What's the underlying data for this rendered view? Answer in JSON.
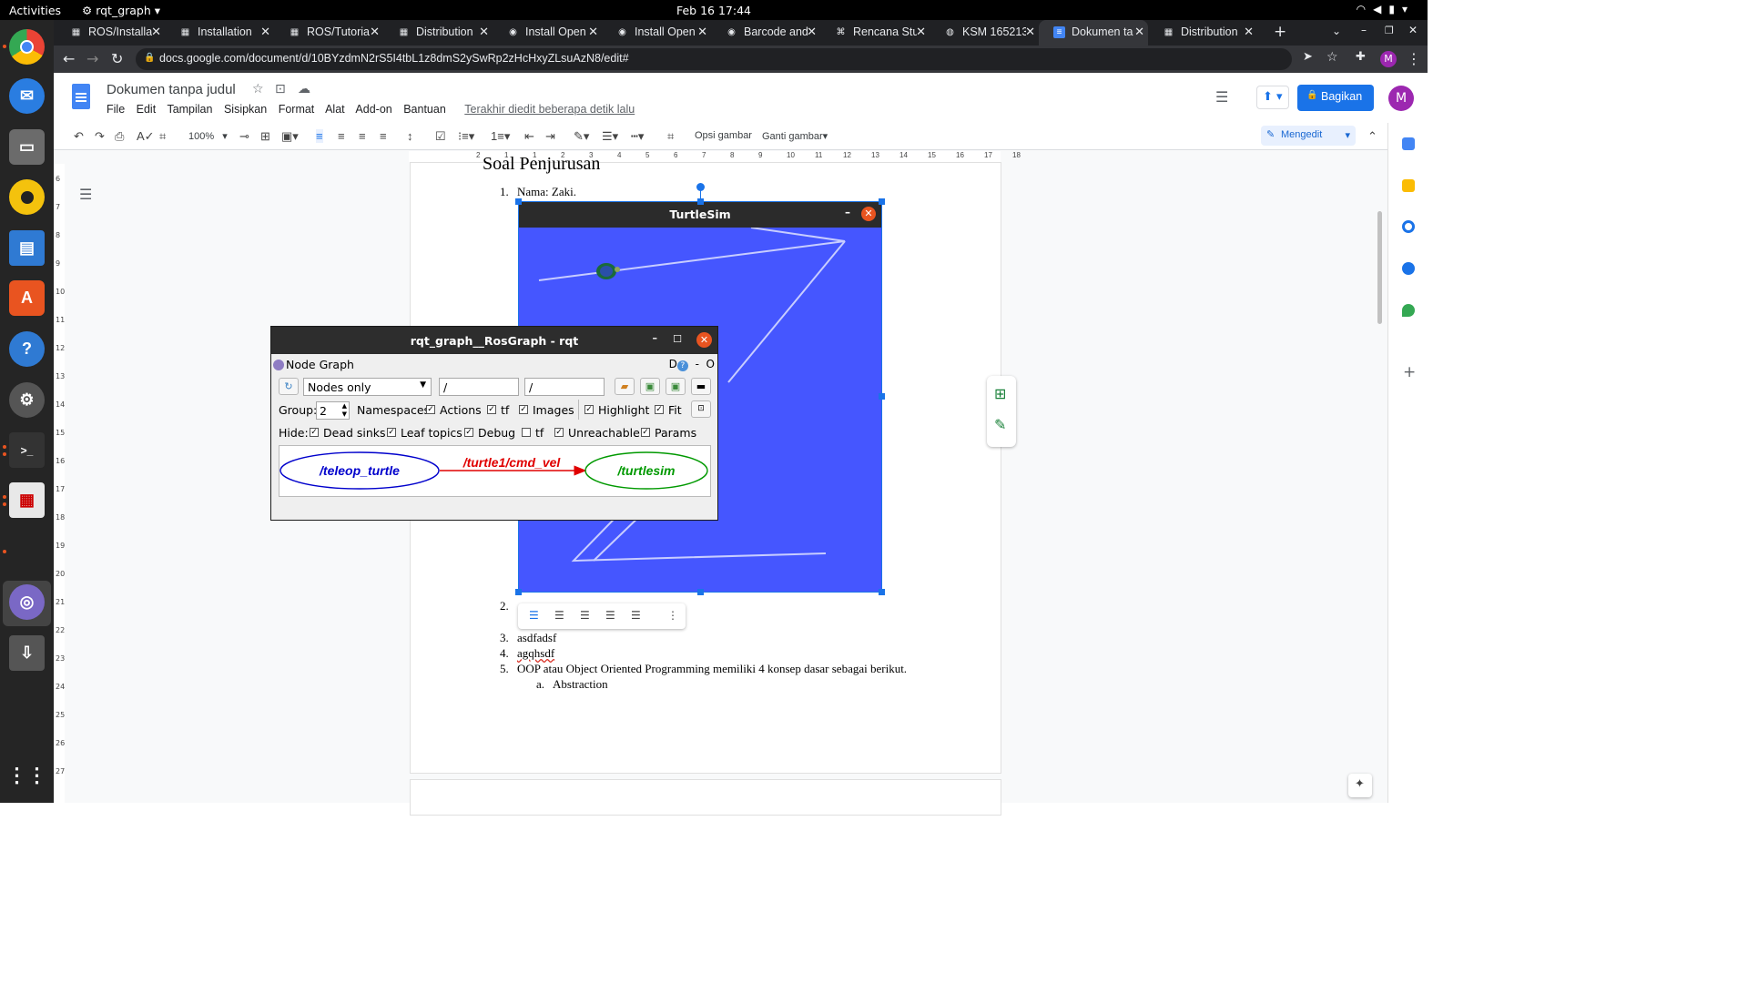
{
  "desktop": {
    "activities": "Activities",
    "app_menu": "rqt_graph",
    "clock": "Feb 16  17:44"
  },
  "browser": {
    "tabs": [
      {
        "label": "ROS/Installa",
        "icon": "grid-icon"
      },
      {
        "label": "Installation",
        "icon": "grid-icon"
      },
      {
        "label": "ROS/Tutoria",
        "icon": "grid-icon"
      },
      {
        "label": "Distribution",
        "icon": "grid-icon"
      },
      {
        "label": "Install Open",
        "icon": "circle-icon"
      },
      {
        "label": "Install Open",
        "icon": "circle-icon"
      },
      {
        "label": "Barcode and",
        "icon": "circle-icon"
      },
      {
        "label": "Rencana Stu",
        "icon": "hook-icon"
      },
      {
        "label": "KSM 165213",
        "icon": "globe-icon"
      },
      {
        "label": "Dokumen ta",
        "icon": "docs-icon"
      },
      {
        "label": "Distribution",
        "icon": "grid-icon"
      }
    ],
    "url": "docs.google.com/document/d/10BYzdmN2rS5I4tbL1z8dmS2ySwRp2zHcHxyZLsuAzN8/edit#"
  },
  "docs": {
    "title": "Dokumen tanpa judul",
    "menus": [
      "File",
      "Edit",
      "Tampilan",
      "Sisipkan",
      "Format",
      "Alat",
      "Add-on",
      "Bantuan"
    ],
    "last_edit": "Terakhir diedit beberapa detik lalu",
    "share_label": "Bagikan",
    "avatar_letter": "M",
    "zoom": "100%",
    "image_options": "Opsi gambar",
    "replace_image": "Ganti gambar",
    "mode": "Mengedit",
    "ruler_marks": [
      "2",
      "1",
      "1",
      "2",
      "3",
      "4",
      "5",
      "6",
      "7",
      "8",
      "9",
      "10",
      "11",
      "12",
      "13",
      "14",
      "15",
      "16",
      "17",
      "18"
    ],
    "vruler_marks": [
      "6",
      "7",
      "8",
      "9",
      "10",
      "11",
      "12",
      "13",
      "14",
      "15",
      "16",
      "17",
      "18",
      "19",
      "20",
      "21",
      "22",
      "23",
      "24",
      "25",
      "26",
      "27"
    ],
    "content": {
      "heading": "Soal Penjurusan",
      "list": [
        {
          "num": "1.",
          "text": "Nama: Zaki."
        },
        {
          "num": "2.",
          "text": ""
        },
        {
          "num": "3.",
          "text": "asdfadsf"
        },
        {
          "num": "4.",
          "text": "agqhsdf"
        },
        {
          "num": "5.",
          "text": "OOP atau Object Oriented Programming memiliki 4 konsep dasar sebagai berikut."
        }
      ],
      "sublist": [
        {
          "num": "a.",
          "text": "Abstraction"
        }
      ]
    },
    "turtlesim_title": "TurtleSim"
  },
  "rqt": {
    "window_title": "rqt_graph__RosGraph - rqt",
    "plugin_title": "Node Graph",
    "right_controls": "D",
    "right_minus": "-",
    "right_o": "O",
    "mode_select": "Nodes only",
    "filter1": "/",
    "filter2": "/",
    "group_label": "Group:",
    "group_value": "2",
    "row2_checks": [
      {
        "label": "Namespaces",
        "checked": true
      },
      {
        "label": "Actions",
        "checked": true
      },
      {
        "label": "tf",
        "checked": true
      },
      {
        "label": "Images",
        "checked": true
      },
      {
        "label": "Highlight",
        "checked": true
      },
      {
        "label": "Fit",
        "checked": true
      }
    ],
    "hide_label": "Hide:",
    "row3_checks": [
      {
        "label": "Dead sinks",
        "checked": true
      },
      {
        "label": "Leaf topics",
        "checked": true
      },
      {
        "label": "Debug",
        "checked": true
      },
      {
        "label": "tf",
        "checked": false
      },
      {
        "label": "Unreachable",
        "checked": true
      },
      {
        "label": "Params",
        "checked": true
      }
    ],
    "graph": {
      "source_node": "/teleop_turtle",
      "topic": "/turtle1/cmd_vel",
      "target_node": "/turtlesim",
      "source_color": "#0000cc",
      "topic_color": "#e00000",
      "target_color": "#009900"
    }
  }
}
